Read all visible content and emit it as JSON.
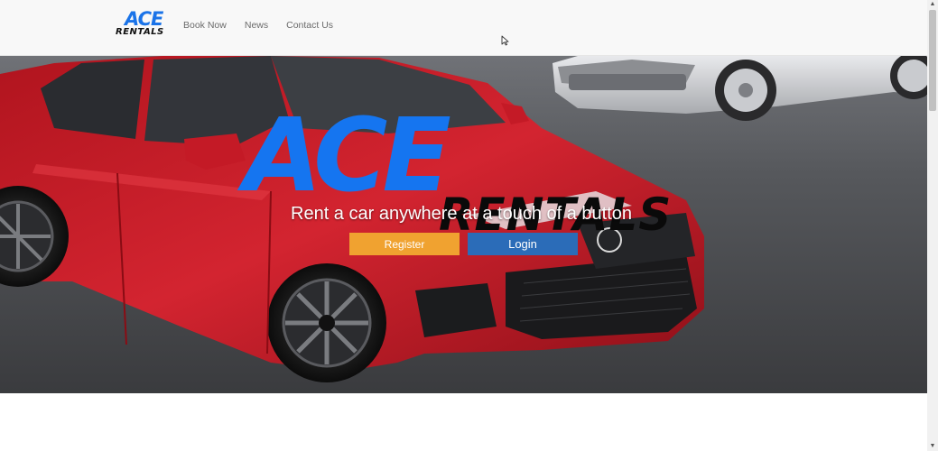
{
  "navbar": {
    "brand": {
      "ace": "ACE",
      "rentals": "RENTALS"
    },
    "links": [
      {
        "label": "Book Now"
      },
      {
        "label": "News"
      },
      {
        "label": "Contact Us"
      }
    ]
  },
  "hero": {
    "logo_ace": "ACE",
    "logo_rentals": "RENTALS",
    "tagline": "Rent a car anywhere at a touch of a button",
    "register_label": "Register",
    "login_label": "Login"
  },
  "colors": {
    "navbar_bg": "#f8f8f8",
    "brand_blue": "#1575f0",
    "register_orange": "#f0a230",
    "login_blue": "#2b6cb8"
  },
  "icons": {
    "cursor": "mouse-pointer-icon",
    "scroll_up": "arrow-up-icon",
    "scroll_down": "arrow-down-icon"
  }
}
